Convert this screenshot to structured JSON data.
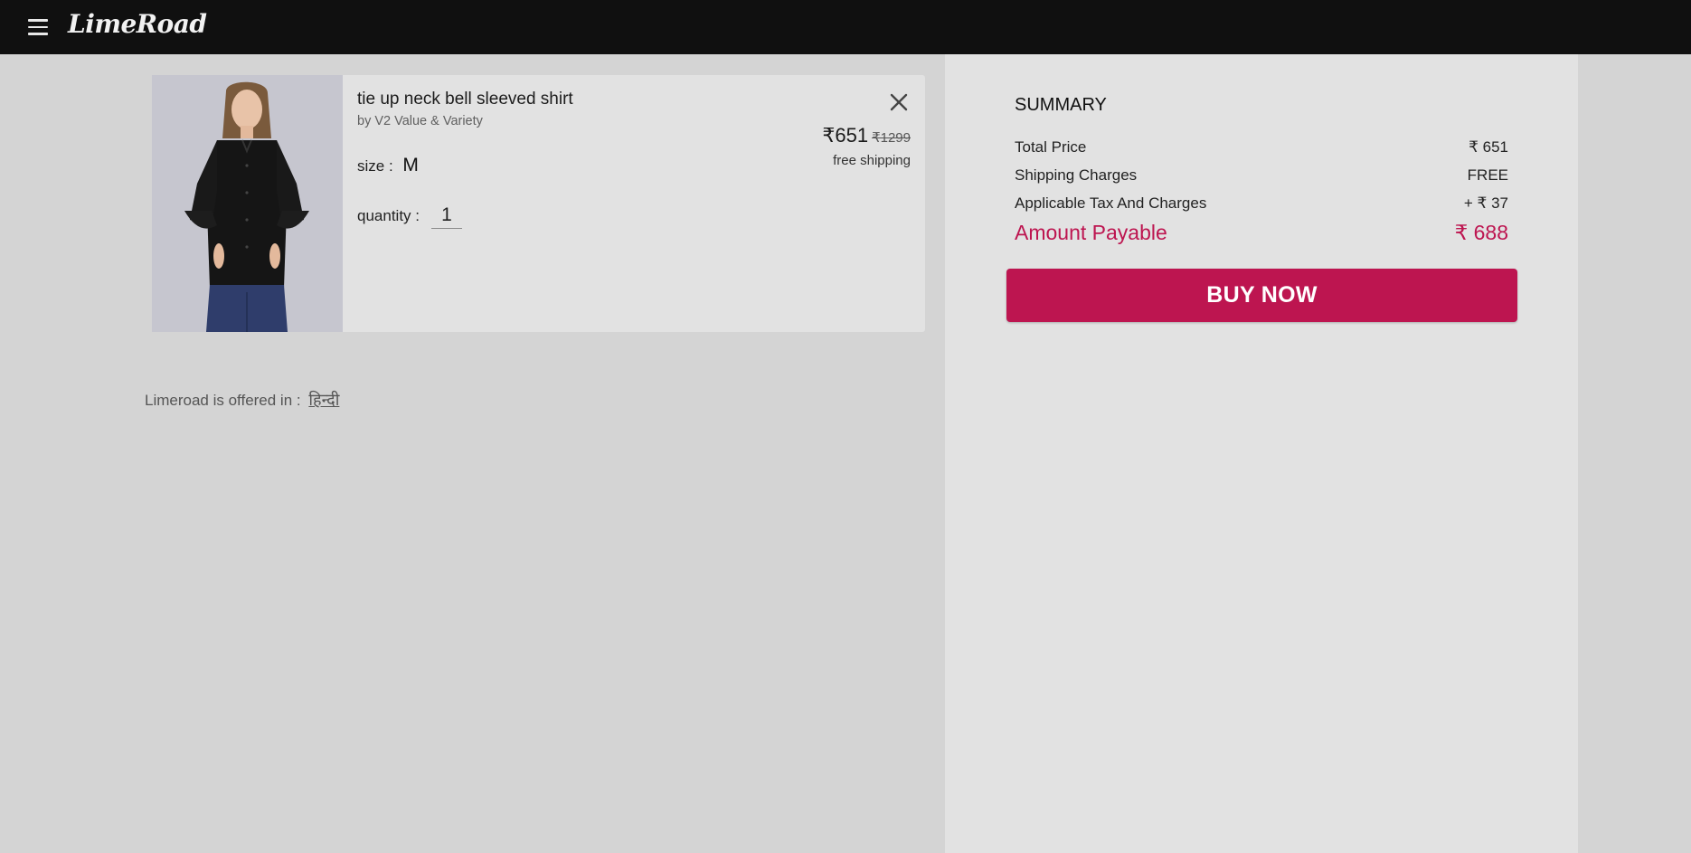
{
  "brand": {
    "logo_text": "LimeRoad"
  },
  "cart_item": {
    "title": "tie up neck bell sleeved shirt",
    "brand_line": "by V2 Value & Variety",
    "size_label": "size :",
    "size_value": "M",
    "quantity_label": "quantity :",
    "quantity_value": "1",
    "price": "₹651",
    "original_price": "₹1299",
    "shipping_note": "free shipping",
    "image_subject": "woman wearing black bell sleeved shirt"
  },
  "footer": {
    "offered_text": "Limeroad is offered in :",
    "language_link": "हिन्दी"
  },
  "summary": {
    "title": "SUMMARY",
    "rows": [
      {
        "label": "Total Price",
        "value": "₹ 651"
      },
      {
        "label": "Shipping Charges",
        "value": "FREE"
      },
      {
        "label": "Applicable Tax And Charges",
        "value": "+ ₹ 37"
      }
    ],
    "payable_label": "Amount Payable",
    "payable_value": "₹ 688",
    "buy_label": "BUY NOW"
  },
  "colors": {
    "accent": "#bd1550",
    "topbar": "#101010",
    "background": "#d4d4d4",
    "panel": "#e2e2e2"
  },
  "icons": [
    "hamburger-menu-icon",
    "close-icon"
  ]
}
